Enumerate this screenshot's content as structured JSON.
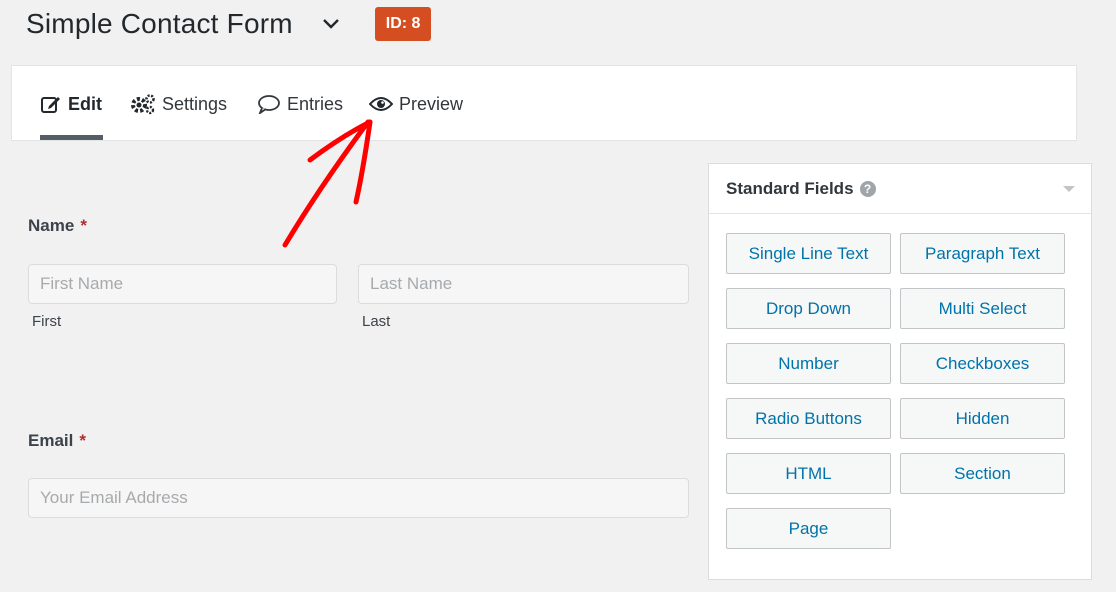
{
  "header": {
    "form_title": "Simple Contact Form",
    "id_badge": "ID: 8"
  },
  "tabs": [
    {
      "label": "Edit",
      "icon": "edit-icon",
      "active": true
    },
    {
      "label": "Settings",
      "icon": "gears-icon"
    },
    {
      "label": "Entries",
      "icon": "speech-bubble-icon"
    },
    {
      "label": "Preview",
      "icon": "eye-icon"
    }
  ],
  "form": {
    "name_field": {
      "label": "Name",
      "required_mark": "*",
      "first_placeholder": "First Name",
      "last_placeholder": "Last Name",
      "first_sublabel": "First",
      "last_sublabel": "Last"
    },
    "email_field": {
      "label": "Email",
      "required_mark": "*",
      "placeholder": "Your Email Address"
    }
  },
  "panel": {
    "title": "Standard Fields",
    "help_icon": "?",
    "buttons": [
      "Single Line Text",
      "Paragraph Text",
      "Drop Down",
      "Multi Select",
      "Number",
      "Checkboxes",
      "Radio Buttons",
      "Hidden",
      "HTML",
      "Section",
      "Page"
    ]
  },
  "colors": {
    "badge": "#d54e21",
    "link_blue": "#0073aa",
    "required_red": "#b32d2e",
    "annotation_arrow": "#ff0000"
  }
}
